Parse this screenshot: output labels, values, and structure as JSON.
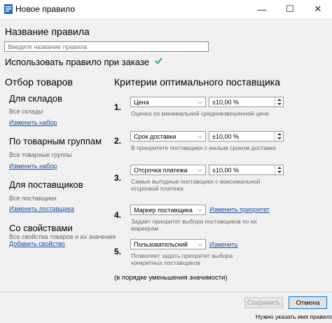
{
  "window": {
    "title": "Новое правило",
    "minimize": "—",
    "maximize": "☐",
    "close": "✕"
  },
  "rule": {
    "name_label": "Название правила",
    "name_placeholder": "Введите название правила",
    "use_label": "Использовать правило при заказе",
    "check_color": "#2aa84a"
  },
  "left": {
    "header": "Отбор товаров",
    "groups": [
      {
        "title": "Для складов",
        "desc": "Все склады",
        "link": "Изменить набор"
      },
      {
        "title": "По товарным группам",
        "desc": "Все товарные группы",
        "link": "Изменить набор"
      },
      {
        "title": "Для поставщиков",
        "desc": "Все поставщики",
        "link": "Изменить поставщика"
      },
      {
        "title": "Со свойствами",
        "desc": "Все свойства товаров и их значения",
        "link": "Добавить свойство"
      }
    ]
  },
  "right": {
    "header": "Критерии оптимального поставщика",
    "criteria": [
      {
        "num": "1.",
        "select": "Цена",
        "value": "±10,00 %",
        "desc": "Оценка по минимальной средневзвешенной цене"
      },
      {
        "num": "2.",
        "select": "Срок доставки",
        "value": "±10,00 %",
        "desc": "В приоритете поставщики с малым сроком доставки"
      },
      {
        "num": "3.",
        "select": "Отсрочка платежа",
        "value": "±10,00 %",
        "desc": "Самые выгодные поставщики с максимальной отсрочкой платежа"
      },
      {
        "num": "4.",
        "select": "Маркер поставщика",
        "link": "Изменить приоритет",
        "desc": "Задаёт приоритет выбора поставщиков по их маркерам"
      },
      {
        "num": "5.",
        "select": "Пользовательский",
        "link": "Изменить",
        "desc": "Позволяет задать приоритет выбора конкретных поставщиков"
      }
    ],
    "note": "(в порядке уменьшения значимости)"
  },
  "footer": {
    "save": "Сохранить",
    "cancel": "Отмена",
    "hint": "Нужно указать имя правила"
  }
}
